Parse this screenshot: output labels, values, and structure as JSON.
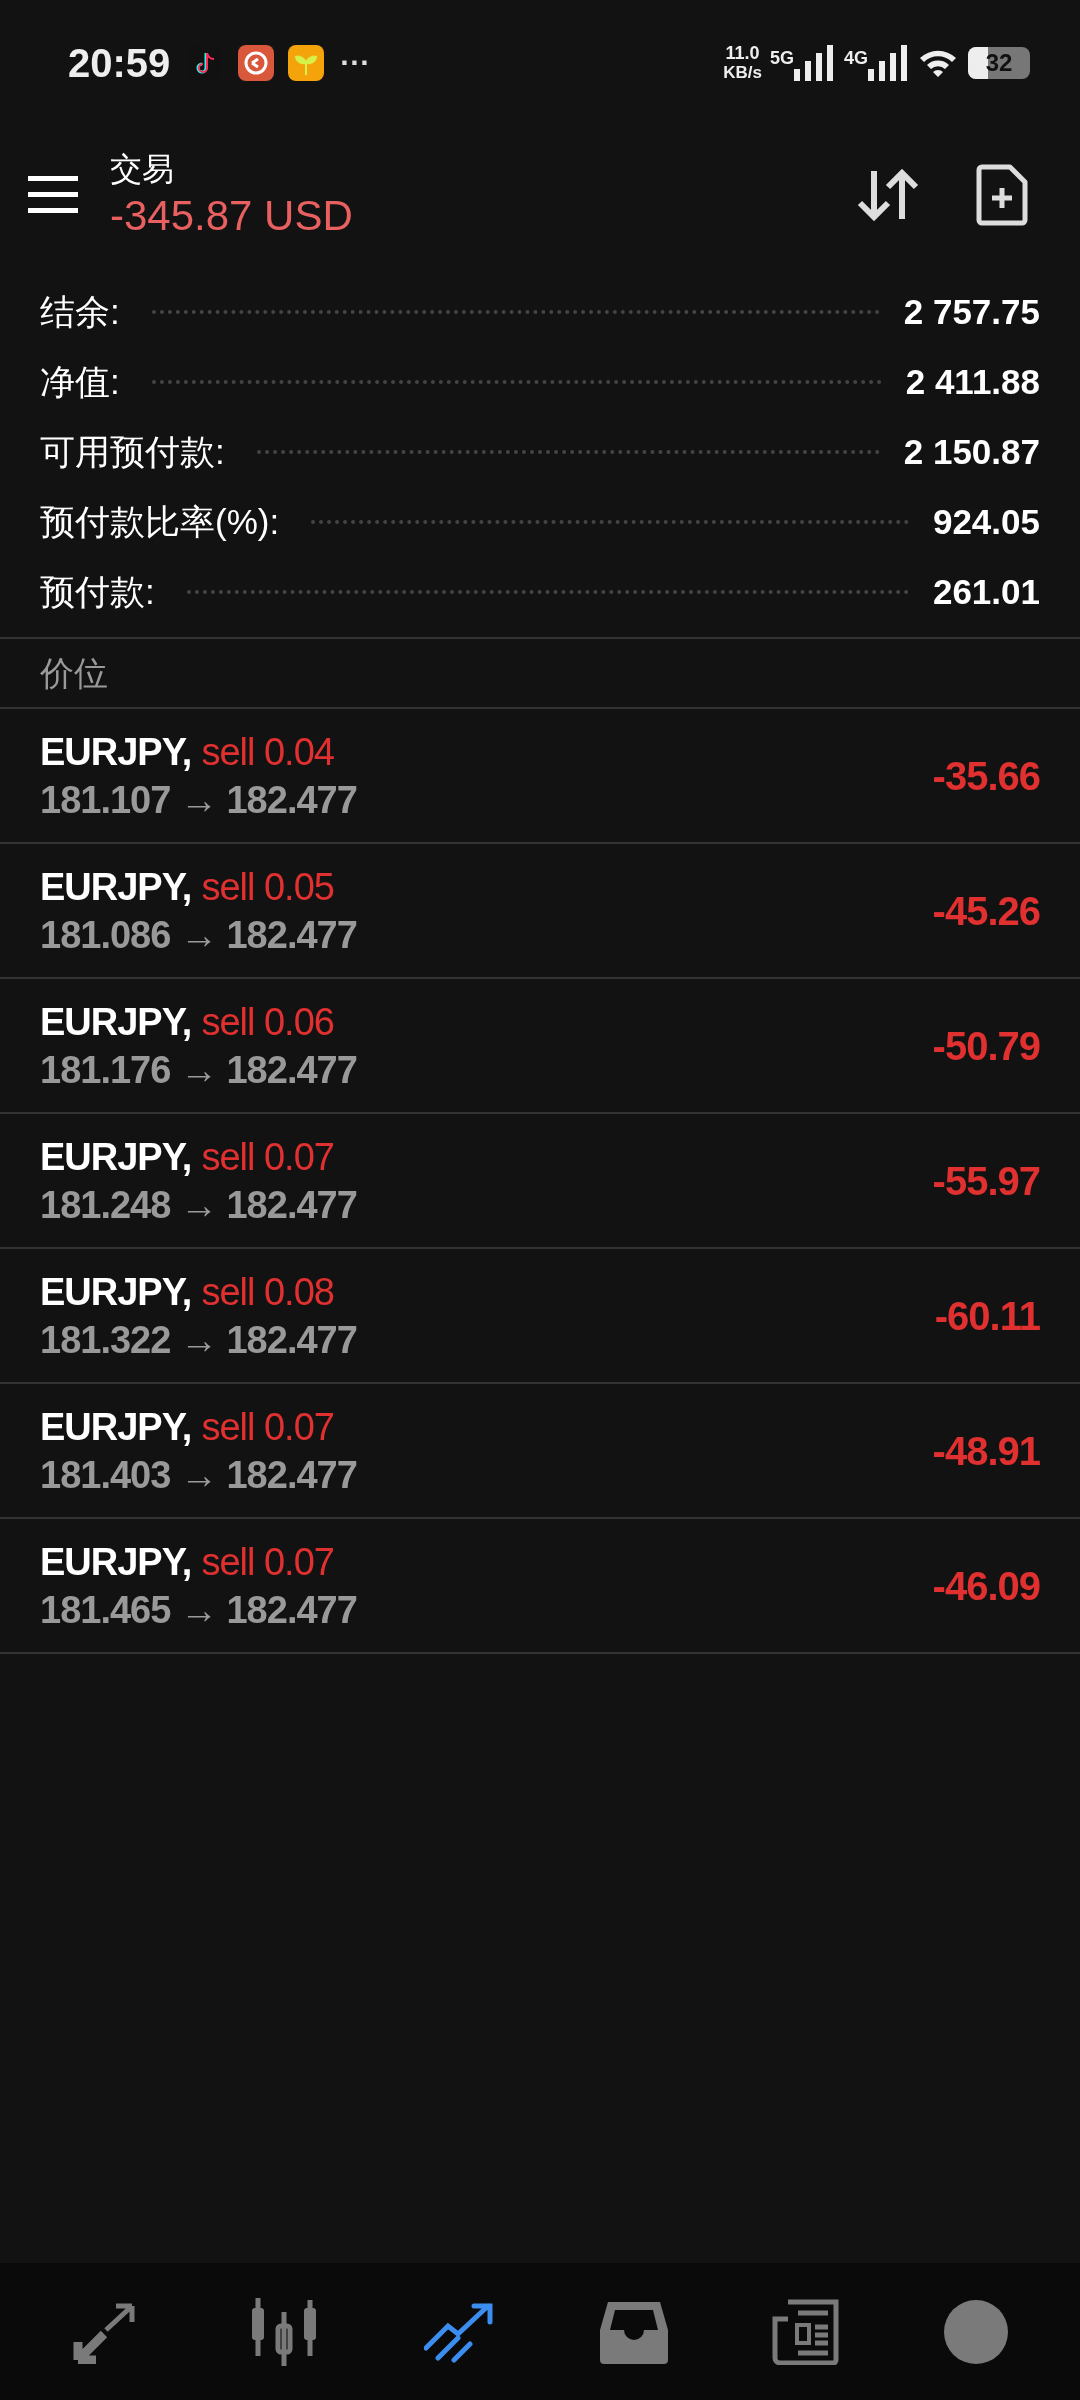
{
  "status_bar": {
    "time": "20:59",
    "more": "···",
    "net_speed": "11.0",
    "net_unit": "KB/s",
    "signal_1": "5G",
    "signal_2": "4G",
    "battery": "32"
  },
  "header": {
    "title": "交易",
    "profit": "-345.87 USD"
  },
  "summary": [
    {
      "label": "结余:",
      "value": "2 757.75"
    },
    {
      "label": "净值:",
      "value": "2 411.88"
    },
    {
      "label": "可用预付款:",
      "value": "2 150.87"
    },
    {
      "label": "预付款比率(%):",
      "value": "924.05"
    },
    {
      "label": "预付款:",
      "value": "261.01"
    }
  ],
  "section": "价位",
  "positions": [
    {
      "symbol": "EURJPY,",
      "order": "sell 0.04",
      "prices": "181.107 → 182.477",
      "profit": "-35.66"
    },
    {
      "symbol": "EURJPY,",
      "order": "sell 0.05",
      "prices": "181.086 → 182.477",
      "profit": "-45.26"
    },
    {
      "symbol": "EURJPY,",
      "order": "sell 0.06",
      "prices": "181.176 → 182.477",
      "profit": "-50.79"
    },
    {
      "symbol": "EURJPY,",
      "order": "sell 0.07",
      "prices": "181.248 → 182.477",
      "profit": "-55.97"
    },
    {
      "symbol": "EURJPY,",
      "order": "sell 0.08",
      "prices": "181.322 → 182.477",
      "profit": "-60.11"
    },
    {
      "symbol": "EURJPY,",
      "order": "sell 0.07",
      "prices": "181.403 → 182.477",
      "profit": "-48.91"
    },
    {
      "symbol": "EURJPY,",
      "order": "sell 0.07",
      "prices": "181.465 → 182.477",
      "profit": "-46.09"
    }
  ],
  "nav": [
    {
      "kind": "quotes",
      "selected": false
    },
    {
      "kind": "chart",
      "selected": false
    },
    {
      "kind": "trade",
      "selected": true
    },
    {
      "kind": "history",
      "selected": false
    },
    {
      "kind": "news",
      "selected": false
    },
    {
      "kind": "chat",
      "selected": false
    }
  ]
}
